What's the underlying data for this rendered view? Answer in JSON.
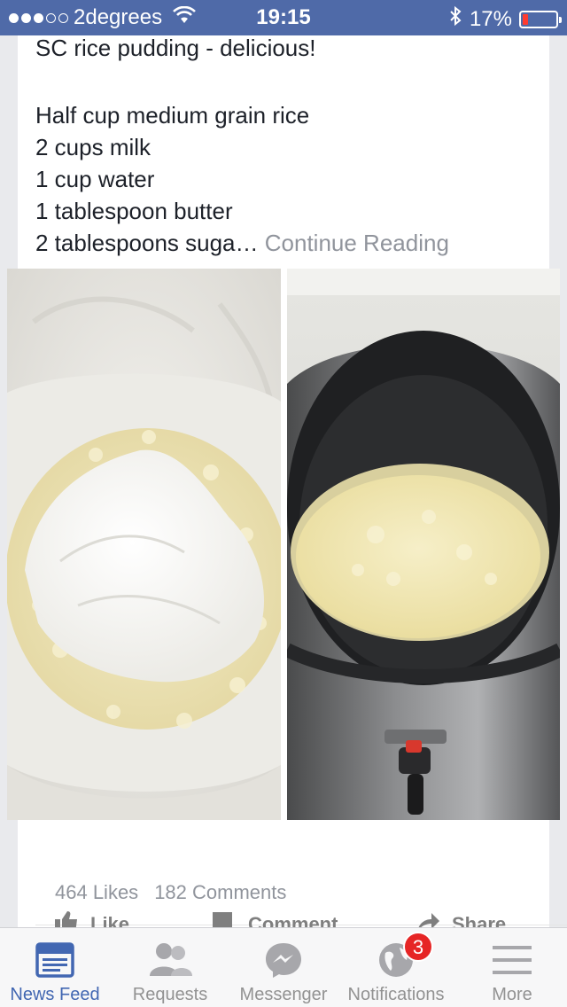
{
  "status_bar": {
    "carrier": "2degrees",
    "time": "19:15",
    "battery_percent_label": "17%",
    "battery_level": 0.17,
    "signal_dots_filled": 3,
    "signal_dots_total": 5
  },
  "post": {
    "title": "SC rice pudding - delicious!",
    "lines": [
      "Half cup medium grain rice",
      "2 cups milk",
      "1 cup water",
      "1 tablespoon butter"
    ],
    "truncated_line": "2 tablespoons suga…",
    "continue_label": "Continue Reading",
    "likes": "464 Likes",
    "comments": "182 Comments"
  },
  "actions": {
    "like": "Like",
    "comment": "Comment",
    "share": "Share"
  },
  "tab_bar": {
    "items": [
      {
        "label": "News Feed",
        "icon": "news-feed-icon"
      },
      {
        "label": "Requests",
        "icon": "friend-requests-icon"
      },
      {
        "label": "Messenger",
        "icon": "messenger-icon"
      },
      {
        "label": "Notifications",
        "icon": "globe-icon",
        "badge": "3"
      },
      {
        "label": "More",
        "icon": "menu-icon"
      }
    ]
  },
  "colors": {
    "status_bar": "#4f6aa8",
    "active_tab": "#4267b2",
    "inactive_tab": "#929292",
    "badge": "#e62525"
  }
}
